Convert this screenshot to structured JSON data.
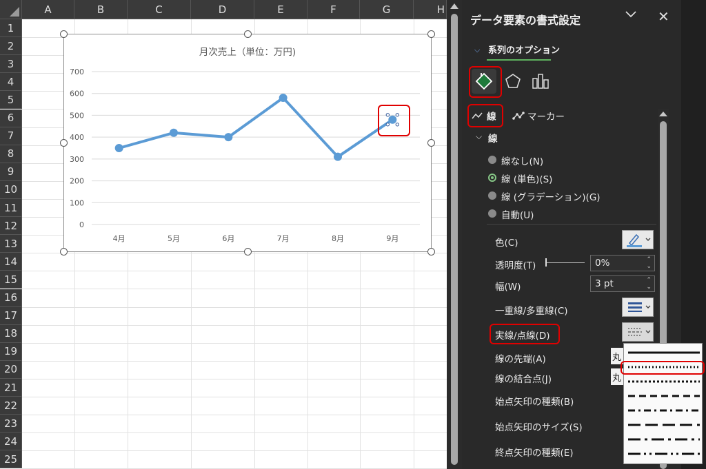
{
  "sheet": {
    "columns": [
      "A",
      "B",
      "C",
      "D",
      "E",
      "F",
      "G",
      "H"
    ],
    "rows": [
      "1",
      "2",
      "3",
      "4",
      "5",
      "6",
      "7",
      "8",
      "9",
      "10",
      "11",
      "12",
      "13",
      "14",
      "15",
      "16",
      "17",
      "18",
      "19",
      "20",
      "21",
      "22",
      "23",
      "24",
      "25"
    ]
  },
  "chart_data": {
    "type": "line",
    "title": "月次売上（単位：万円)",
    "categories": [
      "4月",
      "5月",
      "6月",
      "7月",
      "8月",
      "9月"
    ],
    "values": [
      350,
      420,
      400,
      580,
      310,
      480
    ],
    "ylim": [
      0,
      700
    ],
    "yticks": [
      "0",
      "100",
      "200",
      "300",
      "400",
      "500",
      "600",
      "700"
    ],
    "grid": true,
    "line_color": "#5b9bd5",
    "selected_point": "9月"
  },
  "pane": {
    "title": "データ要素の書式設定",
    "section": "系列のオプション",
    "tabs": {
      "line": "線",
      "marker": "マーカー"
    },
    "line_header": "線",
    "radios": [
      {
        "label": "線なし(N)",
        "selected": false
      },
      {
        "label": "線 (単色)(S)",
        "selected": true
      },
      {
        "label": "線 (グラデーション)(G)",
        "selected": false
      },
      {
        "label": "自動(U)",
        "selected": false
      }
    ],
    "color_label": "色(C)",
    "transparency_label": "透明度(T)",
    "transparency_value": "0%",
    "width_label": "幅(W)",
    "width_value": "3 pt",
    "compound_label": "一重線/多重線(C)",
    "dash_label": "実線/点線(D)",
    "cap_label": "線の先端(A)",
    "cap_value": "丸",
    "join_label": "線の結合点(J)",
    "join_value": "丸",
    "begin_arrow_type": "始点矢印の種類(B)",
    "begin_arrow_size": "始点矢印のサイズ(S)",
    "end_arrow_type": "終点矢印の種類(E)"
  },
  "dash_options": [
    "solid",
    "round-dot",
    "square-dot",
    "dash",
    "dash-dot",
    "long-dash",
    "long-dash-dot",
    "long-dash-dot-dot"
  ],
  "dash_highlighted": "round-dot",
  "colors": {
    "accent_green": "#5fb35f",
    "highlight_red": "#e00000",
    "series_blue": "#5b9bd5"
  }
}
